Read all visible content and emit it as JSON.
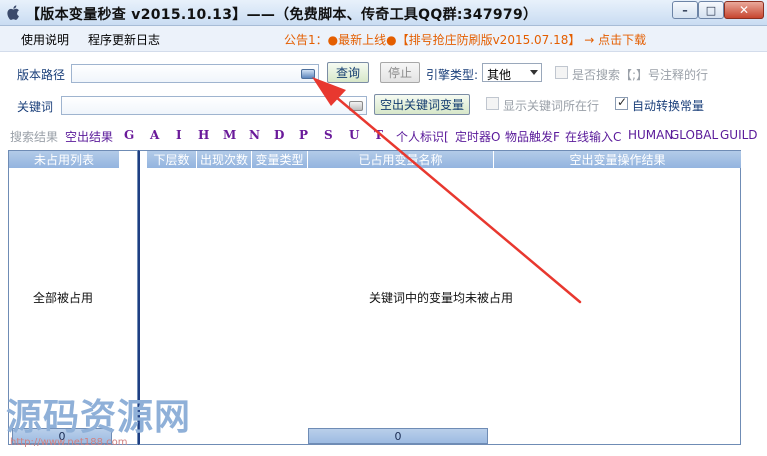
{
  "window": {
    "title": "【版本变量秒查 v2015.10.13】——（免费脚本、传奇工具QQ群:347979）",
    "buttons": {
      "minimize": "–",
      "maximize": "□",
      "close": "✕"
    }
  },
  "menu": {
    "items": [
      "使用说明",
      "程序更新日志"
    ],
    "notice": "公告1：●最新上线●【排号抢庄防刷版v2015.07.18】 → 点击下载"
  },
  "form": {
    "version_path_label": "版本路径",
    "version_path_value": "",
    "keyword_label": "关键词",
    "keyword_value": "",
    "query_button": "查询",
    "stop_button": "停止",
    "engine_type_label": "引擎类型:",
    "engine_type_value": "其他",
    "search_commented_label": "是否搜索【;】号注释的行",
    "search_commented_checked": false,
    "empty_keyword_button": "空出关键词变量",
    "show_keyword_lines_label": "显示关键词所在行",
    "show_keyword_lines_checked": false,
    "auto_convert_label": "自动转换常量",
    "auto_convert_checked": true
  },
  "results": {
    "title": "搜索结果",
    "items": [
      "空出结果",
      "G",
      "A",
      "I",
      "H",
      "M",
      "N",
      "D",
      "P",
      "S",
      "U",
      "T",
      "个人标识[",
      "定时器O",
      "物品触发F",
      "在线输入C",
      "HUMAN",
      "GLOBAL",
      "GUILD"
    ]
  },
  "left_panel": {
    "header": "未占用列表",
    "empty_message": "全部被占用",
    "footer_count": "0"
  },
  "right_panel": {
    "columns": [
      "下层数",
      "出现次数",
      "变量类型",
      "已占用变量名称",
      "空出变量操作结果"
    ],
    "empty_message": "关键词中的变量均未被占用",
    "footer_count": "0"
  },
  "watermark": {
    "text": "源码资源网",
    "url": "http://www.net188.com"
  },
  "colors": {
    "accent_blue": "#1a3f7a",
    "notice_orange": "#e45e00",
    "result_purple": "#6a1a9a",
    "arrow_red": "#e8382f"
  }
}
